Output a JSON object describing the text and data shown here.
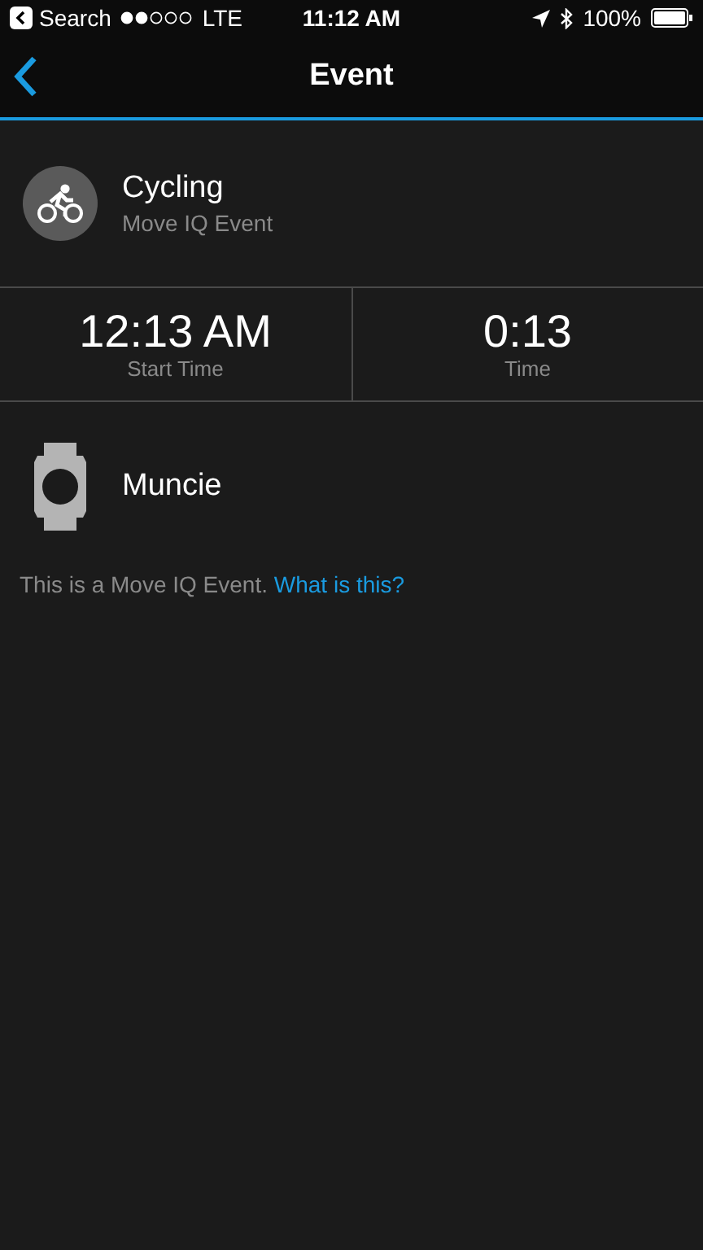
{
  "status_bar": {
    "back_label": "Search",
    "carrier": "LTE",
    "time": "11:12 AM",
    "battery": "100%"
  },
  "nav": {
    "title": "Event"
  },
  "activity": {
    "name": "Cycling",
    "subtitle": "Move IQ Event"
  },
  "stats": [
    {
      "value": "12:13 AM",
      "label": "Start Time"
    },
    {
      "value": "0:13",
      "label": "Time"
    }
  ],
  "device": {
    "name": "Muncie"
  },
  "note": {
    "text": "This is a Move IQ Event.",
    "link": "What is this?"
  }
}
